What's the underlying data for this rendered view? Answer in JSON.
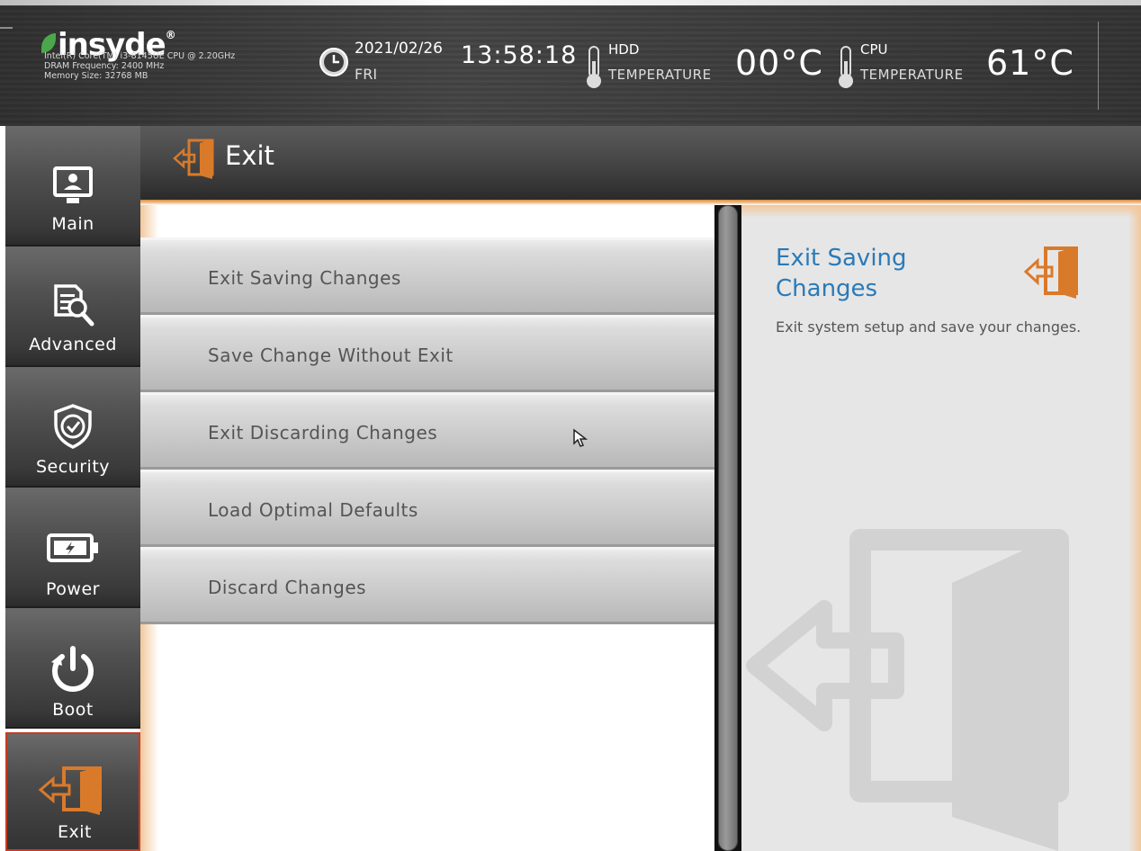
{
  "header": {
    "logo": "insyde",
    "cpu_line": "Intel(R) Core(TM) i3-8145UE CPU @ 2.20GHz",
    "dram_line": "DRAM Frequency: 2400 MHz",
    "memory_line": "Memory Size: 32768 MB",
    "date": "2021/02/26",
    "day": "FRI",
    "time": "13:58:18",
    "hdd": {
      "label_top": "HDD",
      "label_bottom": "TEMPERATURE",
      "value": "00°C"
    },
    "cpu": {
      "label_top": "CPU",
      "label_bottom": "TEMPERATURE",
      "value": "61°C"
    }
  },
  "sidebar": {
    "items": [
      {
        "label": "Main",
        "icon": "monitor-user-icon"
      },
      {
        "label": "Advanced",
        "icon": "document-search-icon"
      },
      {
        "label": "Security",
        "icon": "shield-check-icon"
      },
      {
        "label": "Power",
        "icon": "battery-icon"
      },
      {
        "label": "Boot",
        "icon": "power-icon"
      },
      {
        "label": "Exit",
        "icon": "exit-door-icon",
        "active": true
      }
    ]
  },
  "page": {
    "title": "Exit",
    "menu": [
      {
        "label": "Exit Saving Changes"
      },
      {
        "label": "Save Change Without Exit"
      },
      {
        "label": "Exit Discarding Changes"
      },
      {
        "label": "Load Optimal Defaults"
      },
      {
        "label": "Discard Changes"
      }
    ]
  },
  "help": {
    "title": "Exit Saving Changes",
    "description": "Exit system setup and save your changes."
  },
  "colors": {
    "accent_orange": "#d97a2b",
    "help_title_blue": "#2a7ab8",
    "active_border": "#c83a22"
  }
}
